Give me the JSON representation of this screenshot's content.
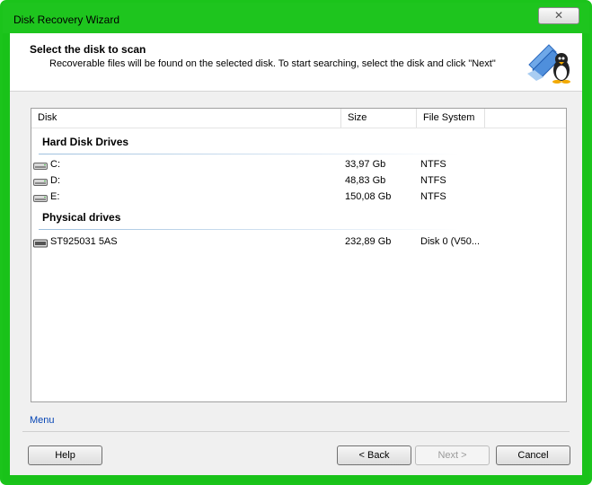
{
  "window": {
    "title": "Disk Recovery Wizard",
    "close_glyph": "✕"
  },
  "header": {
    "title": "Select the disk to scan",
    "description": "Recoverable files will be found on the selected disk. To start searching, select the disk and click \"Next\"",
    "icon": "wizard-folder-penguin-icon"
  },
  "list": {
    "columns": [
      "Disk",
      "Size",
      "File System"
    ],
    "groups": [
      {
        "title": "Hard Disk Drives",
        "rows": [
          {
            "name": "C:",
            "size": "33,97 Gb",
            "fs": "NTFS",
            "icon": "hard-drive-icon"
          },
          {
            "name": "D:",
            "size": "48,83 Gb",
            "fs": "NTFS",
            "icon": "hard-drive-icon"
          },
          {
            "name": "E:",
            "size": "150,08 Gb",
            "fs": "NTFS",
            "icon": "hard-drive-icon"
          }
        ]
      },
      {
        "title": "Physical drives",
        "rows": [
          {
            "name": "ST925031 5AS",
            "size": "232,89 Gb",
            "fs": "Disk 0 (V50...",
            "icon": "physical-drive-icon"
          }
        ]
      }
    ]
  },
  "footer": {
    "menu_label": "Menu",
    "help_label": "Help",
    "back_label": "< Back",
    "next_label": "Next >",
    "cancel_label": "Cancel"
  },
  "colors": {
    "frame": "#1bc41b",
    "link": "#0645b4",
    "group_line": "#9ec0de"
  }
}
